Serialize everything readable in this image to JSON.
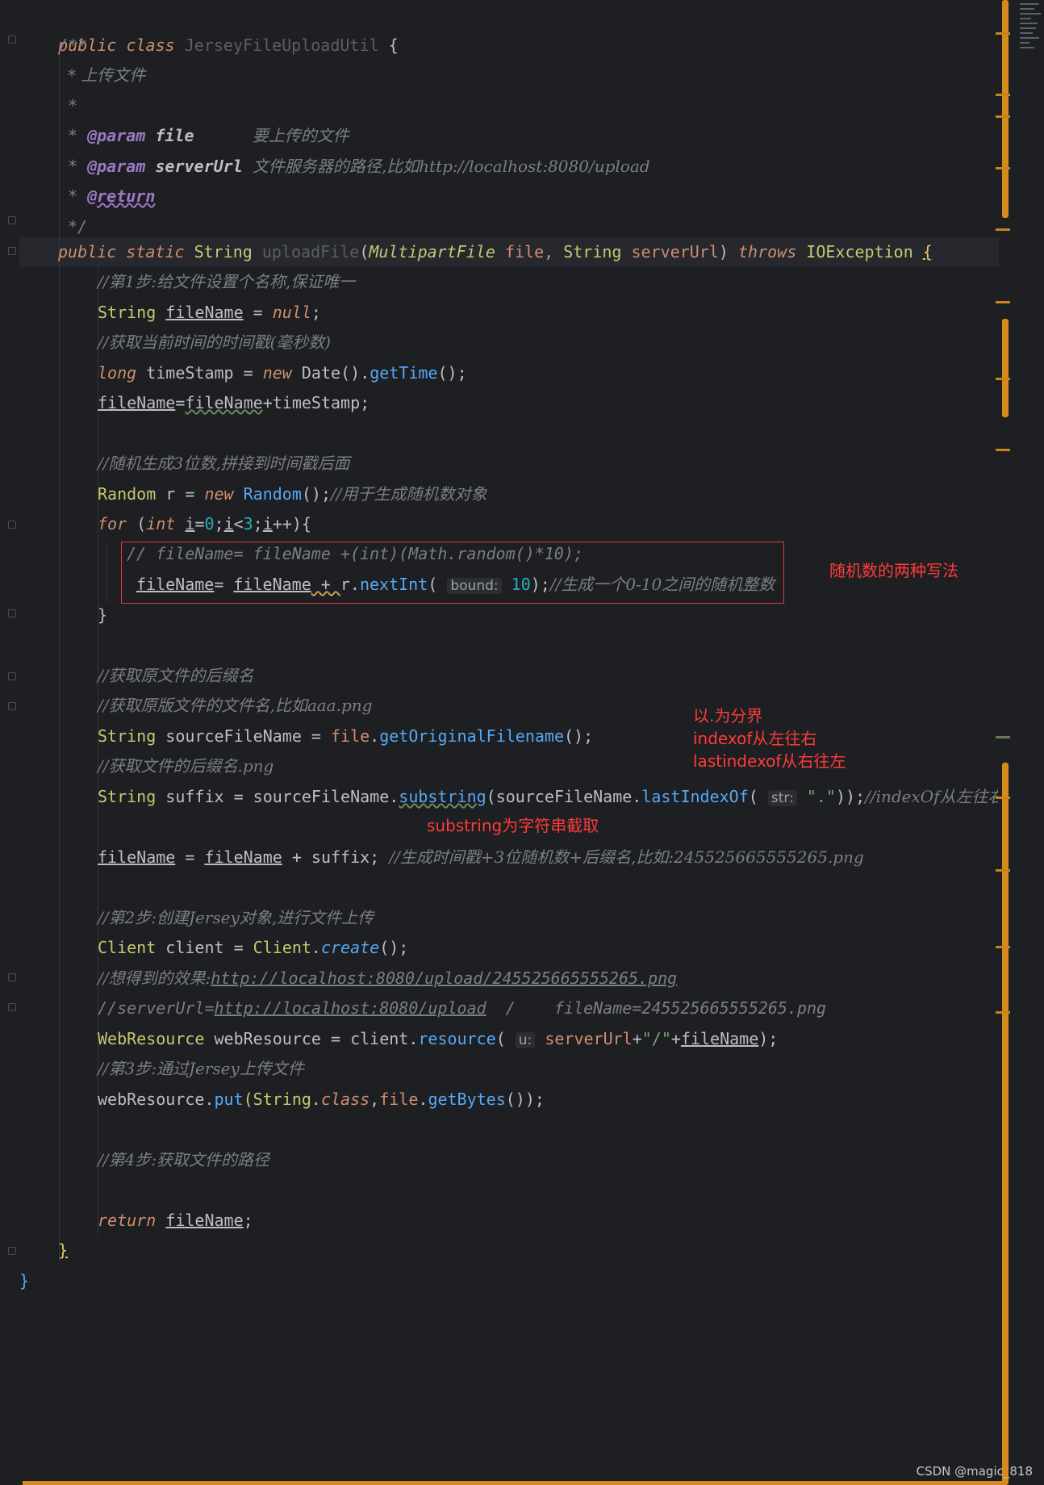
{
  "code": {
    "class_decl": {
      "public": "public",
      "class": "class",
      "name": "JerseyFileUploadUtil",
      "brace": "{"
    },
    "javadoc": {
      "open": "/**",
      "desc": "* 上传文件",
      "blank": "*",
      "param1_star": "*",
      "param1_tag": "@param",
      "param1_name": "file",
      "param1_desc": "要上传的文件",
      "param2_star": "*",
      "param2_tag": "@param",
      "param2_name": "serverUrl",
      "param2_desc": "文件服务器的路径,比如http://localhost:8080/upload",
      "return_star": "*",
      "return_tag": "@return",
      "close": "*/"
    },
    "method": {
      "public": "public",
      "static": "static",
      "ret": "String",
      "name": "uploadFile",
      "p_open": "(",
      "p1_type": "MultipartFile",
      "p1_name": "file,",
      "p2_type": "String",
      "p2_name": "serverUrl",
      "p_close": ")",
      "throws": "throws",
      "ex": "IOException",
      "brace": "{"
    },
    "body": {
      "c1": "//第1步:给文件设置个名称,保证唯一",
      "l1_type": "String",
      "l1_var": "fileName",
      "l1_eq": " = ",
      "l1_val": "null",
      "l1_semi": ";",
      "c2": "//获取当前时间的时间戳(毫秒数)",
      "l2_type": "long",
      "l2_var": " timeStamp = ",
      "l2_new": "new",
      "l2_cls": " Date",
      "l2_call1": "().",
      "l2_m": "getTime",
      "l2_end": "();",
      "l3_a": "fileName",
      "l3_eq": "=",
      "l3_b": "fileName",
      "l3_rest": "+timeStamp;",
      "c3": "//随机生成3位数,拼接到时间戳后面",
      "l4_type": "Random",
      "l4_var": " r = ",
      "l4_new": "new",
      "l4_cls": " Random",
      "l4_end": "();",
      "l4_cm": "//用于生成随机数对象",
      "for_kw": "for",
      "for_open": " (",
      "for_int": "int",
      "for_i1": "i",
      "for_eq": "=",
      "for_0": "0",
      "for_s1": ";",
      "for_i2": "i",
      "for_lt": "<",
      "for_3": "3",
      "for_s2": ";",
      "for_i3": "i",
      "for_end": "++){",
      "c_rand": "// fileName= fileName +(int)(Math.random()*10);",
      "l5_a": "fileName",
      "l5_eq": "= ",
      "l5_b": "fileName",
      "l5_plus": " + ",
      "l5_r": "r.",
      "l5_m": "nextInt",
      "l5_open": "( ",
      "l5_hint": "bound:",
      "l5_num": " 10",
      "l5_end": ");",
      "l5_cm": "//生成一个0-10之间的随机整数",
      "for_close": "}",
      "c4": "//获取原文件的后缀名",
      "c5": "//获取原版文件的文件名,比如aaa.png",
      "l6_type": "String",
      "l6_var": " sourceFileName = ",
      "l6_obj": "file",
      "l6_dot": ".",
      "l6_m": "getOriginalFilename",
      "l6_end": "();",
      "c6": "//获取文件的后缀名.png",
      "l7_type": "String",
      "l7_var": " suffix = sourceFileName.",
      "l7_m": "substring",
      "l7_mid": "(sourceFileName.",
      "l7_m2": "lastIndexOf",
      "l7_open": "( ",
      "l7_hint": "str:",
      "l7_str": " \".\"",
      "l7_end": "));",
      "l7_cm": "//indexOf从左往右",
      "l8_a": "fileName",
      "l8_eq": " = ",
      "l8_b": "fileName",
      "l8_rest": " + suffix; ",
      "l8_cm": "//生成时间戳+3位随机数+后缀名,比如:245525665555265.png",
      "c7": "//第2步:创建Jersey对象,进行文件上传",
      "l9_type": "Client",
      "l9_var": " client = ",
      "l9_cls": "Client",
      "l9_dot": ".",
      "l9_m": "create",
      "l9_end": "();",
      "c8_a": "//想得到的效果:",
      "c8_url": "http://localhost:8080/upload/245525665555265.png",
      "c9_a": "//serverUrl=",
      "c9_url": "http://localhost:8080/upload",
      "c9_rest": "  /    fileName=245525665555265.png",
      "l10_type": "WebResource",
      "l10_var": " webResource = client.",
      "l10_m": "resource",
      "l10_open": "( ",
      "l10_hint": "u:",
      "l10_p": " serverUrl",
      "l10_plus": "+",
      "l10_str": "\"/\"",
      "l10_plus2": "+",
      "l10_f": "fileName",
      "l10_end": ");",
      "c10": "//第3步:通过Jersey上传文件",
      "l11_a": "webResource.",
      "l11_m": "put",
      "l11_open": "(String.",
      "l11_kw": "class",
      "l11_comma": ",",
      "l11_file": "file",
      "l11_dot": ".",
      "l11_m2": "getBytes",
      "l11_end": "());",
      "c11": "//第4步:获取文件的路径",
      "ret_kw": "return",
      "ret_sp": " ",
      "ret_var": "fileName",
      "ret_semi": ";",
      "method_close": "}",
      "class_close": "}"
    }
  },
  "annotations": {
    "random_two_ways": "随机数的两种写法",
    "split_by_dot": "以.为分界",
    "indexof": "indexof从左往右",
    "lastindexof": "lastindexof从右往左",
    "substring": "substring为字符串截取"
  },
  "watermark": "CSDN @magic_818",
  "colors": {
    "accent": "#d48a1c",
    "annotation": "#ff3b3b",
    "background": "#1e1f22"
  }
}
